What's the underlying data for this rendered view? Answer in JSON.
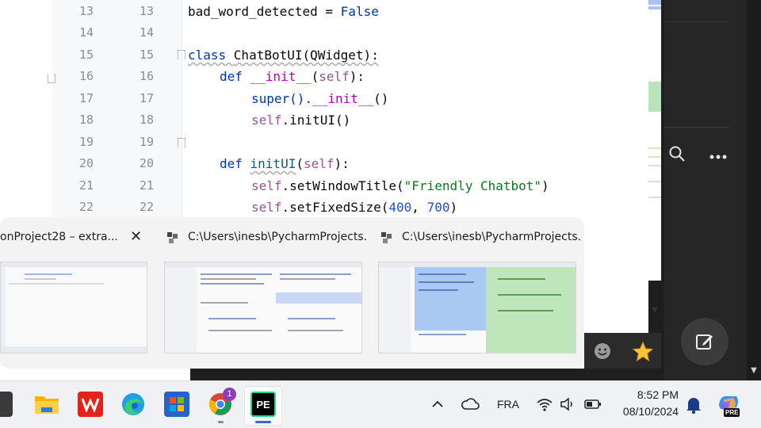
{
  "editor": {
    "lines": [
      {
        "left": "13",
        "right": "13"
      },
      {
        "left": "14",
        "right": "14"
      },
      {
        "left": "15",
        "right": "15"
      },
      {
        "left": "16",
        "right": "16"
      },
      {
        "left": "17",
        "right": "17"
      },
      {
        "left": "18",
        "right": "18"
      },
      {
        "left": "19",
        "right": "19"
      },
      {
        "left": "20",
        "right": "20"
      },
      {
        "left": "21",
        "right": "21"
      },
      {
        "left": "22",
        "right": "22"
      }
    ],
    "code": {
      "l13_var": "bad_word_detected",
      "l13_eq": " = ",
      "l13_val": "False",
      "l15_kw": "class ",
      "l15_name": "ChatBotUI(QWidget):",
      "l16_kw": "def ",
      "l16_name": "__init__",
      "l16_open": "(",
      "l16_self": "self",
      "l16_close": "):",
      "l17_super": "super().",
      "l17_init": "__init__",
      "l17_call": "()",
      "l18_self": "self",
      "l18_rest": ".initUI()",
      "l20_kw": "def ",
      "l20_name": "initUI",
      "l20_open": "(",
      "l20_self": "self",
      "l20_close": "):",
      "l21_self": "self",
      "l21_mid": ".setWindowTitle(",
      "l21_str": "\"Friendly Chatbot\"",
      "l21_end": ")",
      "l22_self": "self",
      "l22_mid": ".setFixedSize(",
      "l22_n1": "400",
      "l22_sep": ", ",
      "l22_n2": "700",
      "l22_end": ")"
    }
  },
  "task_view": {
    "windows": [
      {
        "title": "onProject28 – extra..."
      },
      {
        "title": "C:\\Users\\inesb\\PycharmProjects..."
      },
      {
        "title": "C:\\Users\\inesb\\PycharmProjects..."
      }
    ],
    "close_glyph": "✕"
  },
  "side_panel": {
    "search_glyph": "⚲",
    "more_glyph": "•••",
    "star_glyph": "★",
    "emoji_glyph": "☻"
  },
  "taskbar": {
    "chrome_badge": "1",
    "pycharm_label": "PE",
    "tray": {
      "chevron": "^",
      "language": "FRA",
      "time": "8:52 PM",
      "date": "08/10/2024",
      "copilot_badge": "PRE"
    }
  },
  "colors": {
    "keyword": "#0033b3",
    "self": "#94558d",
    "string": "#067d17",
    "number": "#1750eb",
    "dunder": "#b200b2",
    "taskbar_bg": "#f0f1f5"
  }
}
